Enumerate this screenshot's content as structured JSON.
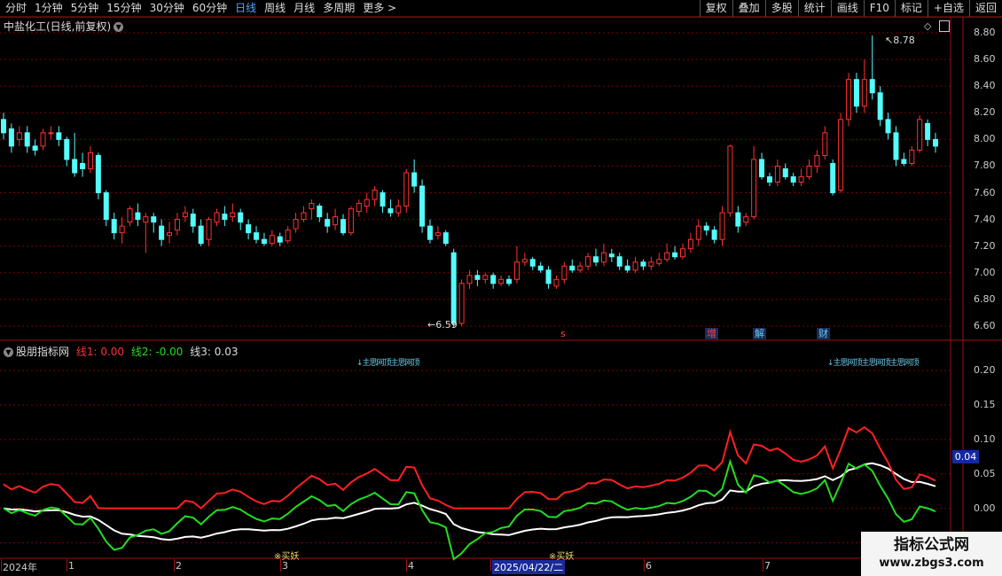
{
  "toolbar": {
    "periods": [
      {
        "label": "分时",
        "active": false
      },
      {
        "label": "1分钟",
        "active": false
      },
      {
        "label": "5分钟",
        "active": false
      },
      {
        "label": "15分钟",
        "active": false
      },
      {
        "label": "30分钟",
        "active": false
      },
      {
        "label": "60分钟",
        "active": false
      },
      {
        "label": "日线",
        "active": true
      },
      {
        "label": "周线",
        "active": false
      },
      {
        "label": "月线",
        "active": false
      },
      {
        "label": "多周期",
        "active": false
      },
      {
        "label": "更多 >",
        "active": false
      }
    ],
    "buttons": [
      "复权",
      "叠加",
      "多股",
      "统计",
      "画线",
      "F10",
      "标记",
      "+自选",
      "返回"
    ]
  },
  "chart_title": "中盐化工(日线,前复权)",
  "price_axis": [
    "8.80",
    "8.60",
    "8.40",
    "8.20",
    "8.00",
    "7.80",
    "7.60",
    "7.40",
    "7.20",
    "7.00",
    "6.80",
    "6.60"
  ],
  "high_label": "8.78",
  "low_label": "6.59",
  "event_markers": [
    {
      "text": "s",
      "color": "#ff4040"
    },
    {
      "text": "增",
      "color": "#ff4040"
    },
    {
      "text": "解",
      "color": "#6cc8e8"
    },
    {
      "text": "财",
      "color": "#6cc8e8"
    }
  ],
  "indicator": {
    "name": "股朋指标网",
    "line1": "线1: 0.00",
    "line2": "线2: -0.00",
    "line3": "线3: 0.03",
    "axis": [
      "0.20",
      "0.15",
      "0.10",
      "0.05",
      "0.00",
      "-0.05"
    ],
    "current": "0.04",
    "top_signal_1": "↓主思网顶主思网顶",
    "top_signal_2": "↓主思网顶主思网顶主思网顶",
    "buy_signal_1": "※买妖",
    "buy_signal_2": "※买妖"
  },
  "x_axis": [
    {
      "label": "2024年",
      "hl": false
    },
    {
      "label": "1",
      "hl": false
    },
    {
      "label": "2",
      "hl": false
    },
    {
      "label": "3",
      "hl": false
    },
    {
      "label": "4",
      "hl": false
    },
    {
      "label": "2025/04/22/二",
      "hl": true
    },
    {
      "label": "6",
      "hl": false
    },
    {
      "label": "7",
      "hl": false
    }
  ],
  "watermark": {
    "line1": "指标公式网",
    "line2": "www.zbgs3.com"
  },
  "colors": {
    "up": "#ff3232",
    "down": "#54fcfc",
    "line1": "#ff2020",
    "line2": "#22dd22",
    "line3": "#ffffff",
    "grid": "#7a0000"
  },
  "chart_data": {
    "type": "candlestick",
    "title": "中盐化工(日线,前复权)",
    "ylim": [
      6.5,
      8.9
    ],
    "candles": [
      [
        8.15,
        8.05,
        8.2,
        8.0
      ],
      [
        8.08,
        7.95,
        8.12,
        7.9
      ],
      [
        8.0,
        8.05,
        8.1,
        7.95
      ],
      [
        8.05,
        7.95,
        8.1,
        7.9
      ],
      [
        7.95,
        7.92,
        8.0,
        7.88
      ],
      [
        7.95,
        8.05,
        8.08,
        7.92
      ],
      [
        8.05,
        8.05,
        8.1,
        8.0
      ],
      [
        8.05,
        8.0,
        8.1,
        7.95
      ],
      [
        8.0,
        7.85,
        8.02,
        7.8
      ],
      [
        7.85,
        7.75,
        8.05,
        7.72
      ],
      [
        7.82,
        7.78,
        7.9,
        7.72
      ],
      [
        7.78,
        7.9,
        7.95,
        7.75
      ],
      [
        7.88,
        7.6,
        7.9,
        7.55
      ],
      [
        7.6,
        7.4,
        7.62,
        7.35
      ],
      [
        7.4,
        7.3,
        7.45,
        7.25
      ],
      [
        7.3,
        7.35,
        7.42,
        7.22
      ],
      [
        7.38,
        7.48,
        7.5,
        7.35
      ],
      [
        7.45,
        7.4,
        7.52,
        7.35
      ],
      [
        7.38,
        7.42,
        7.45,
        7.15
      ],
      [
        7.42,
        7.38,
        7.45,
        7.3
      ],
      [
        7.35,
        7.25,
        7.4,
        7.2
      ],
      [
        7.28,
        7.3,
        7.38,
        7.22
      ],
      [
        7.32,
        7.4,
        7.45,
        7.28
      ],
      [
        7.42,
        7.45,
        7.5,
        7.38
      ],
      [
        7.44,
        7.35,
        7.48,
        7.3
      ],
      [
        7.35,
        7.22,
        7.4,
        7.2
      ],
      [
        7.25,
        7.4,
        7.42,
        7.2
      ],
      [
        7.38,
        7.45,
        7.48,
        7.35
      ],
      [
        7.44,
        7.4,
        7.5,
        7.35
      ],
      [
        7.42,
        7.45,
        7.52,
        7.38
      ],
      [
        7.45,
        7.38,
        7.48,
        7.32
      ],
      [
        7.36,
        7.3,
        7.4,
        7.25
      ],
      [
        7.3,
        7.25,
        7.35,
        7.22
      ],
      [
        7.25,
        7.22,
        7.3,
        7.2
      ],
      [
        7.22,
        7.28,
        7.32,
        7.2
      ],
      [
        7.27,
        7.23,
        7.3,
        7.2
      ],
      [
        7.24,
        7.32,
        7.35,
        7.22
      ],
      [
        7.33,
        7.4,
        7.45,
        7.3
      ],
      [
        7.4,
        7.45,
        7.5,
        7.38
      ],
      [
        7.48,
        7.52,
        7.55,
        7.4
      ],
      [
        7.5,
        7.42,
        7.52,
        7.38
      ],
      [
        7.4,
        7.35,
        7.45,
        7.3
      ],
      [
        7.36,
        7.42,
        7.48,
        7.32
      ],
      [
        7.4,
        7.3,
        7.44,
        7.28
      ],
      [
        7.3,
        7.48,
        7.5,
        7.28
      ],
      [
        7.46,
        7.52,
        7.55,
        7.42
      ],
      [
        7.5,
        7.55,
        7.6,
        7.45
      ],
      [
        7.55,
        7.62,
        7.65,
        7.5
      ],
      [
        7.6,
        7.5,
        7.62,
        7.45
      ],
      [
        7.48,
        7.45,
        7.55,
        7.42
      ],
      [
        7.45,
        7.5,
        7.55,
        7.42
      ],
      [
        7.5,
        7.75,
        7.78,
        7.45
      ],
      [
        7.75,
        7.65,
        7.85,
        7.6
      ],
      [
        7.65,
        7.35,
        7.7,
        7.3
      ],
      [
        7.35,
        7.25,
        7.4,
        7.22
      ],
      [
        7.28,
        7.3,
        7.35,
        7.25
      ],
      [
        7.3,
        7.22,
        7.32,
        7.2
      ],
      [
        7.15,
        6.62,
        7.18,
        6.59
      ],
      [
        6.62,
        6.92,
        6.95,
        6.6
      ],
      [
        6.92,
        6.98,
        7.02,
        6.88
      ],
      [
        6.98,
        6.95,
        7.02,
        6.9
      ],
      [
        6.95,
        6.98,
        7.0,
        6.92
      ],
      [
        6.98,
        6.92,
        7.0,
        6.88
      ],
      [
        6.92,
        6.95,
        6.98,
        6.9
      ],
      [
        6.95,
        6.92,
        6.98,
        6.9
      ],
      [
        6.95,
        7.08,
        7.2,
        6.92
      ],
      [
        7.08,
        7.1,
        7.15,
        7.05
      ],
      [
        7.1,
        7.05,
        7.12,
        7.02
      ],
      [
        7.05,
        7.02,
        7.08,
        7.0
      ],
      [
        7.02,
        6.92,
        7.05,
        6.88
      ],
      [
        6.9,
        6.95,
        6.98,
        6.88
      ],
      [
        6.95,
        7.05,
        7.08,
        6.92
      ],
      [
        7.05,
        7.02,
        7.1,
        7.0
      ],
      [
        7.02,
        7.05,
        7.08,
        7.0
      ],
      [
        7.05,
        7.12,
        7.15,
        7.02
      ],
      [
        7.12,
        7.08,
        7.18,
        7.05
      ],
      [
        7.08,
        7.15,
        7.22,
        7.05
      ],
      [
        7.14,
        7.12,
        7.18,
        7.08
      ],
      [
        7.12,
        7.05,
        7.15,
        7.02
      ],
      [
        7.05,
        7.02,
        7.1,
        7.0
      ],
      [
        7.02,
        7.08,
        7.12,
        7.0
      ],
      [
        7.08,
        7.05,
        7.1,
        7.02
      ],
      [
        7.05,
        7.08,
        7.12,
        7.02
      ],
      [
        7.07,
        7.1,
        7.15,
        7.05
      ],
      [
        7.1,
        7.15,
        7.22,
        7.08
      ],
      [
        7.15,
        7.12,
        7.2,
        7.1
      ],
      [
        7.12,
        7.18,
        7.22,
        7.1
      ],
      [
        7.18,
        7.25,
        7.3,
        7.15
      ],
      [
        7.25,
        7.35,
        7.4,
        7.2
      ],
      [
        7.35,
        7.32,
        7.38,
        7.28
      ],
      [
        7.32,
        7.25,
        7.35,
        7.22
      ],
      [
        7.25,
        7.45,
        7.5,
        7.2
      ],
      [
        7.45,
        7.95,
        7.96,
        7.42
      ],
      [
        7.45,
        7.35,
        7.5,
        7.3
      ],
      [
        7.38,
        7.42,
        7.45,
        7.35
      ],
      [
        7.42,
        7.85,
        7.95,
        7.4
      ],
      [
        7.85,
        7.72,
        7.9,
        7.7
      ],
      [
        7.72,
        7.68,
        7.75,
        7.65
      ],
      [
        7.68,
        7.8,
        7.85,
        7.65
      ],
      [
        7.78,
        7.72,
        7.82,
        7.7
      ],
      [
        7.72,
        7.68,
        7.75,
        7.65
      ],
      [
        7.68,
        7.72,
        7.78,
        7.65
      ],
      [
        7.72,
        7.8,
        7.85,
        7.7
      ],
      [
        7.8,
        7.88,
        7.92,
        7.75
      ],
      [
        7.88,
        8.05,
        8.1,
        7.85
      ],
      [
        7.82,
        7.6,
        7.85,
        7.58
      ],
      [
        7.62,
        8.15,
        8.2,
        7.6
      ],
      [
        8.15,
        8.45,
        8.5,
        8.1
      ],
      [
        8.45,
        8.25,
        8.5,
        8.2
      ],
      [
        8.25,
        8.45,
        8.6,
        8.2
      ],
      [
        8.45,
        8.35,
        8.78,
        8.3
      ],
      [
        8.35,
        8.15,
        8.4,
        8.1
      ],
      [
        8.15,
        8.05,
        8.2,
        8.0
      ],
      [
        8.05,
        7.85,
        8.1,
        7.8
      ],
      [
        7.85,
        7.82,
        7.9,
        7.8
      ],
      [
        7.82,
        7.92,
        7.95,
        7.8
      ],
      [
        7.92,
        8.15,
        8.18,
        7.9
      ],
      [
        8.12,
        8.0,
        8.15,
        7.95
      ],
      [
        8.0,
        7.95,
        8.05,
        7.9
      ]
    ],
    "indicator_series": [
      {
        "name": "线1",
        "ylim": [
          -0.07,
          0.23
        ]
      },
      {
        "name": "线2"
      },
      {
        "name": "线3"
      }
    ]
  }
}
